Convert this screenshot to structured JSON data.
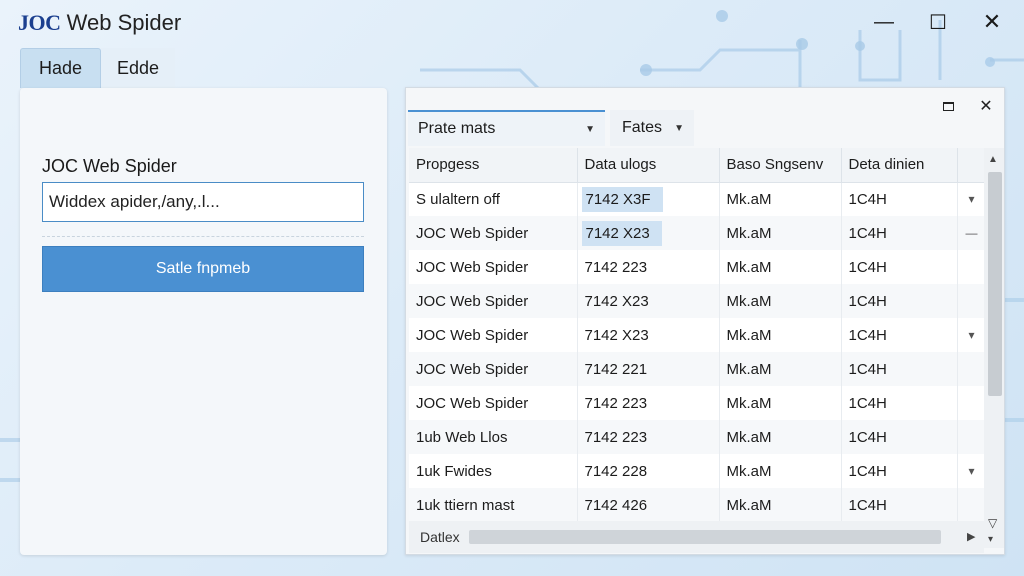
{
  "app": {
    "title_brand": "JOC",
    "title_rest": " Web Spider"
  },
  "window_controls": {
    "minimize": "—",
    "maximize": "☐",
    "close": "✕"
  },
  "left_tabs": [
    {
      "label": "Hade",
      "active": true
    },
    {
      "label": "Edde",
      "active": false
    }
  ],
  "left_panel": {
    "heading": "JOC Web Spider",
    "input_value": "Widdex apider,/any,.l...",
    "button_label": "Satle fnpmeb"
  },
  "right_panel": {
    "dropdowns": [
      {
        "label": "Prate mats"
      },
      {
        "label": "Fates"
      }
    ],
    "columns": [
      "Propgess",
      "Data ulogs",
      "Baso Sngsenv",
      "Deta dinien"
    ],
    "rows": [
      {
        "c1": "S ulaltern off",
        "c2": "7142 X3F",
        "c3": "Mk.aM",
        "c4": "1C4H",
        "mark": "▾",
        "hl": true
      },
      {
        "c1": "JOC Web Spider",
        "c2": "7142 X23",
        "c3": "Mk.aM",
        "c4": "1C4H",
        "mark": "—",
        "hl": true
      },
      {
        "c1": "JOC Web Spider",
        "c2": "7142 223",
        "c3": "Mk.aM",
        "c4": "1C4H",
        "mark": "",
        "hl": false
      },
      {
        "c1": "JOC Web Spider",
        "c2": "7142 X23",
        "c3": "Mk.aM",
        "c4": "1C4H",
        "mark": "",
        "hl": false
      },
      {
        "c1": "JOC Web Spider",
        "c2": "7142 X23",
        "c3": "Mk.aM",
        "c4": "1C4H",
        "mark": "▾",
        "hl": false
      },
      {
        "c1": "JOC Web Spider",
        "c2": "7142 221",
        "c3": "Mk.aM",
        "c4": "1C4H",
        "mark": "",
        "hl": false
      },
      {
        "c1": "JOC Web Spider",
        "c2": "7142 223",
        "c3": "Mk.aM",
        "c4": "1C4H",
        "mark": "",
        "hl": false
      },
      {
        "c1": "1ub Web Llos",
        "c2": "7142 223",
        "c3": "Mk.aM",
        "c4": "1C4H",
        "mark": "",
        "hl": false
      },
      {
        "c1": "1uk Fwides",
        "c2": "7142 228",
        "c3": "Mk.aM",
        "c4": "1C4H",
        "mark": "▾",
        "hl": false
      },
      {
        "c1": "1uk ttiern mast",
        "c2": "7142 426",
        "c3": "Mk.aM",
        "c4": "1C4H",
        "mark": "",
        "hl": false
      }
    ],
    "status_label": "Datlex"
  },
  "colors": {
    "accent": "#4a90d2",
    "brand": "#1b3f8f",
    "highlight": "#cfe2f3"
  }
}
